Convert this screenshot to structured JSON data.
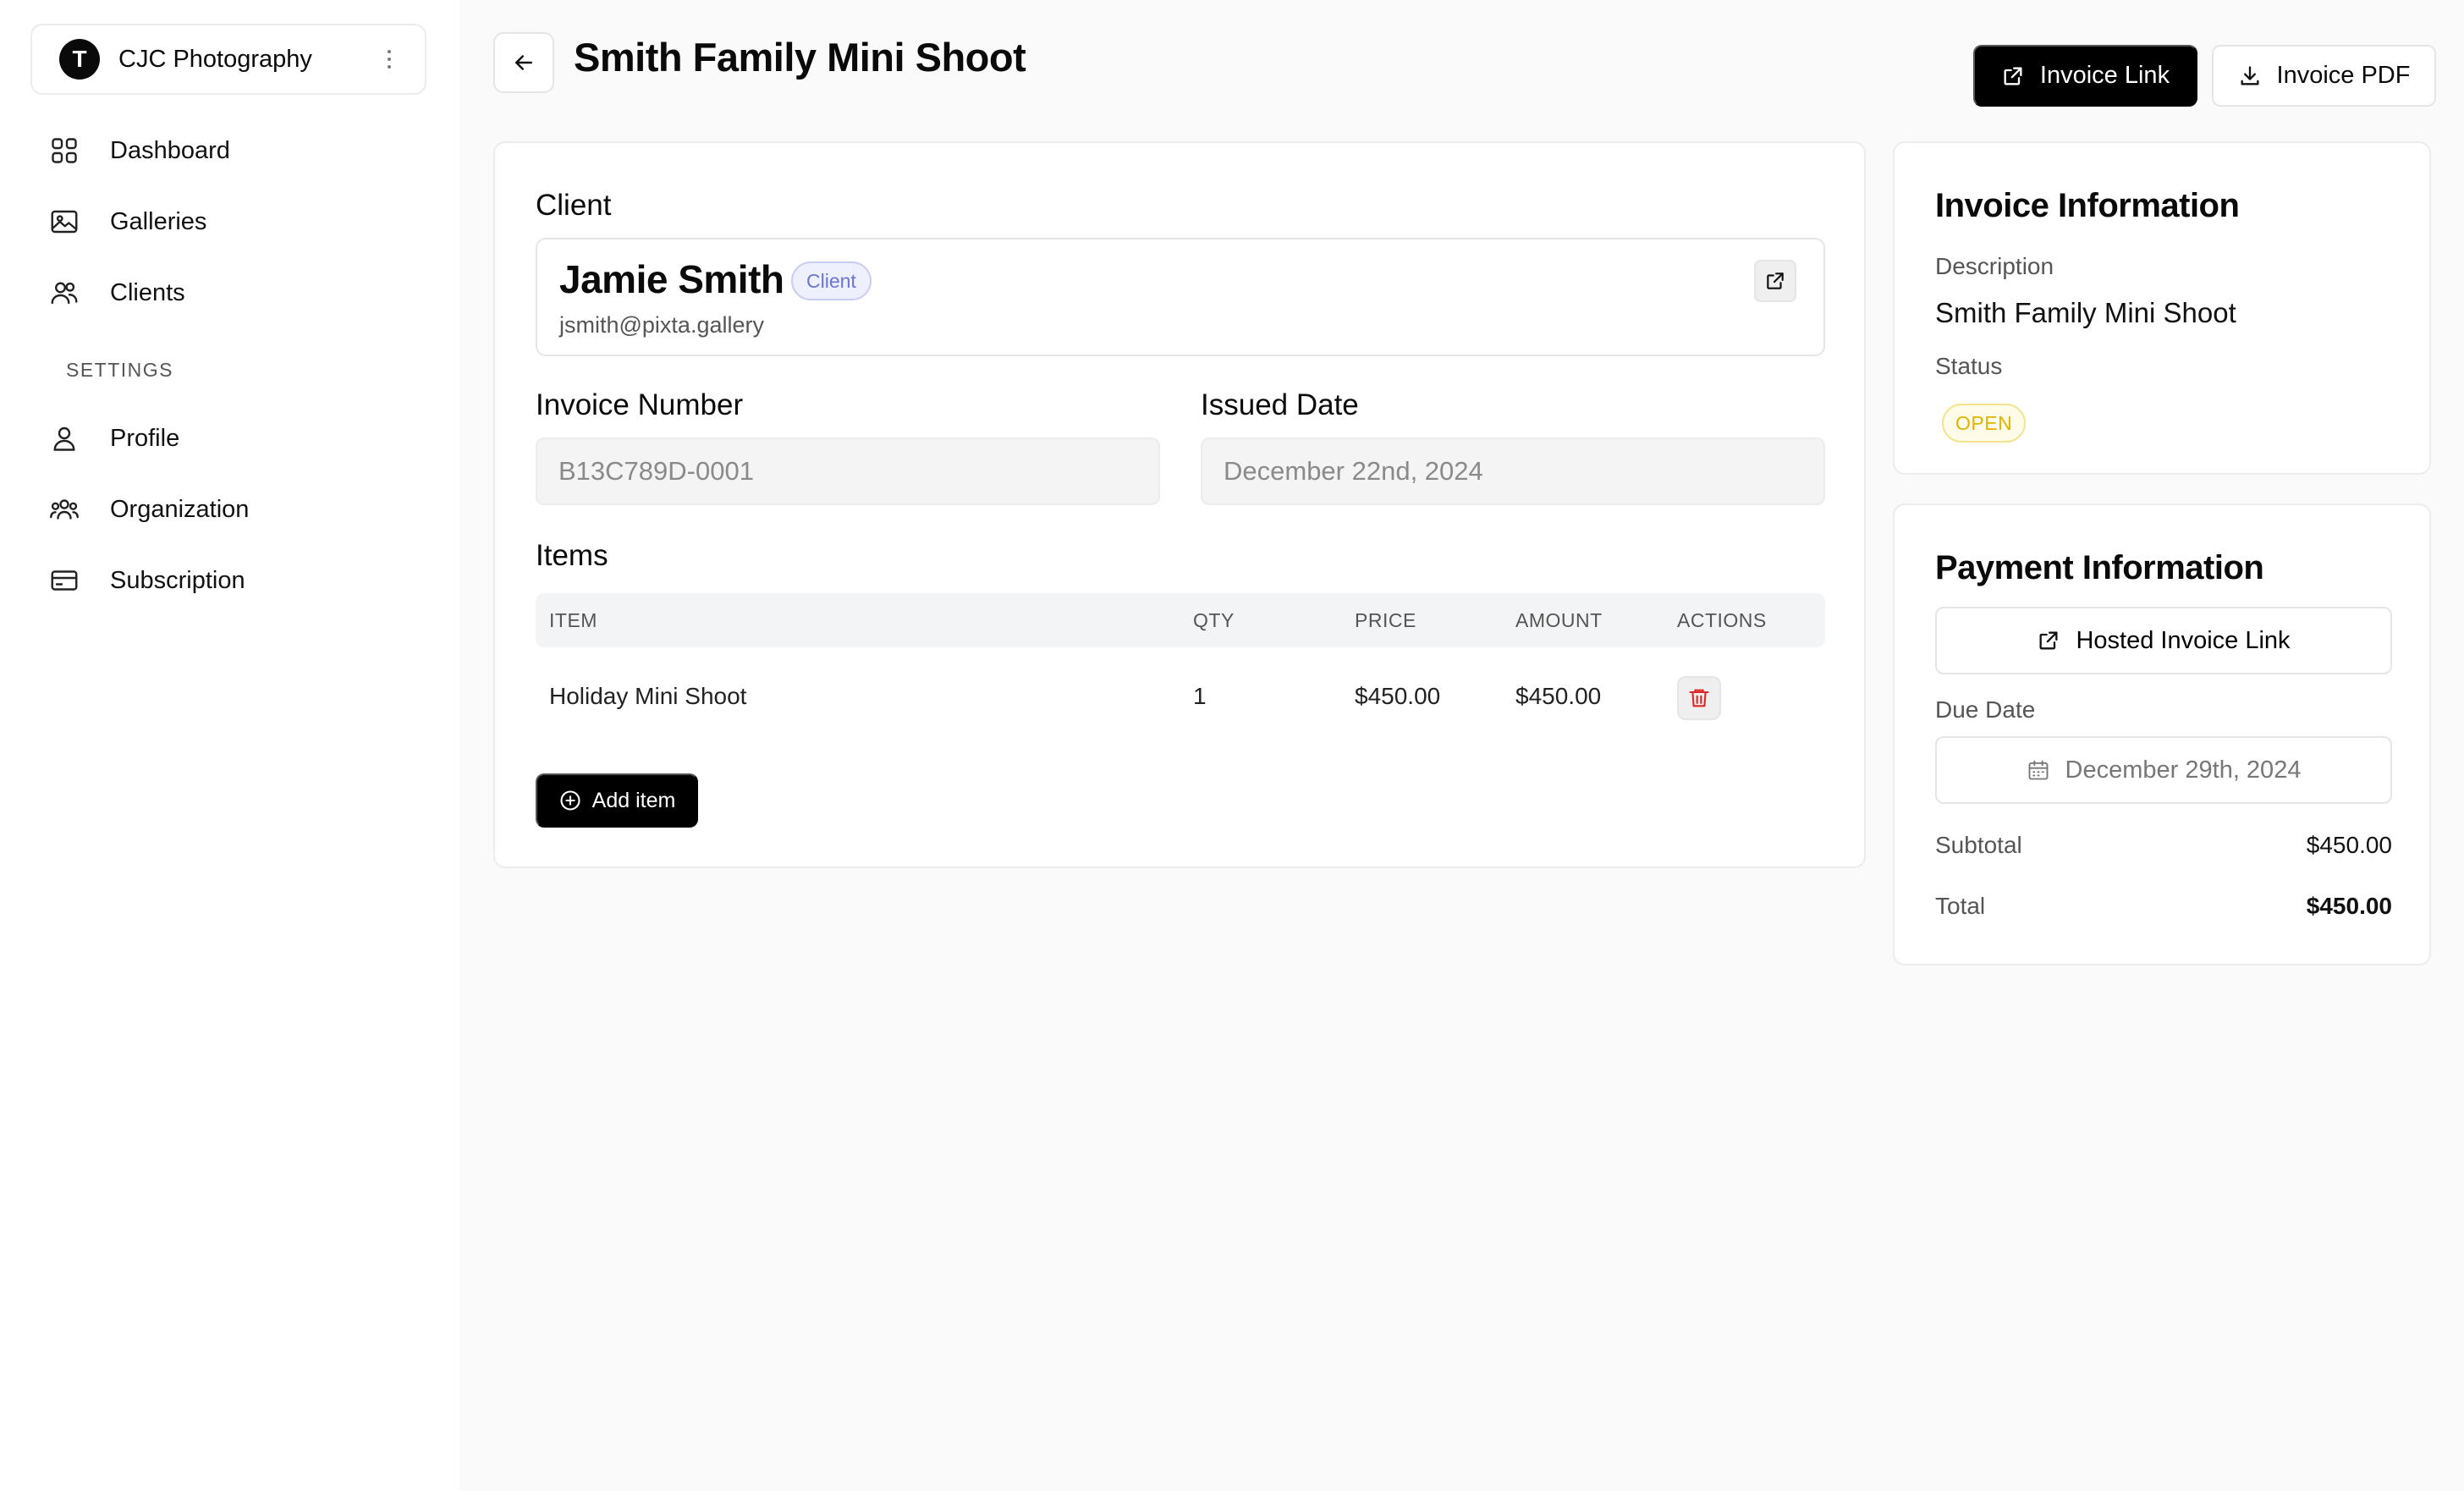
{
  "sidebar": {
    "org": {
      "initial": "T",
      "name": "CJC Photography"
    },
    "nav": [
      {
        "label": "Dashboard",
        "icon": "grid-icon"
      },
      {
        "label": "Galleries",
        "icon": "image-icon"
      },
      {
        "label": "Clients",
        "icon": "users-icon"
      }
    ],
    "settings_heading": "SETTINGS",
    "settings": [
      {
        "label": "Profile",
        "icon": "user-icon"
      },
      {
        "label": "Organization",
        "icon": "team-icon"
      },
      {
        "label": "Subscription",
        "icon": "credit-card-icon"
      }
    ]
  },
  "header": {
    "title": "Smith Family Mini Shoot",
    "invoice_link_label": "Invoice Link",
    "invoice_pdf_label": "Invoice PDF"
  },
  "invoice_form": {
    "client_label": "Client",
    "client": {
      "name": "Jamie Smith",
      "badge": "Client",
      "email": "jsmith@pixta.gallery"
    },
    "invoice_number_label": "Invoice Number",
    "invoice_number_value": "B13C789D-0001",
    "issued_date_label": "Issued Date",
    "issued_date_value": "December 22nd, 2024",
    "items_label": "Items",
    "columns": [
      "ITEM",
      "QTY",
      "PRICE",
      "AMOUNT",
      "ACTIONS"
    ],
    "items": [
      {
        "item": "Holiday Mini Shoot",
        "qty": "1",
        "price": "$450.00",
        "amount": "$450.00"
      }
    ],
    "add_item_label": "Add item"
  },
  "invoice_info": {
    "title": "Invoice Information",
    "description_label": "Description",
    "description_value": "Smith Family Mini Shoot",
    "status_label": "Status",
    "status_value": "OPEN"
  },
  "payment_info": {
    "title": "Payment Information",
    "hosted_link_label": "Hosted Invoice Link",
    "due_date_label": "Due Date",
    "due_date_value": "December 29th, 2024",
    "subtotal_label": "Subtotal",
    "subtotal_value": "$450.00",
    "total_label": "Total",
    "total_value": "$450.00"
  },
  "colors": {
    "primary": "#000000",
    "background": "#fafafa",
    "client_badge": "#6b74d8",
    "status_open": "#e0b400",
    "danger": "#dc2626"
  }
}
